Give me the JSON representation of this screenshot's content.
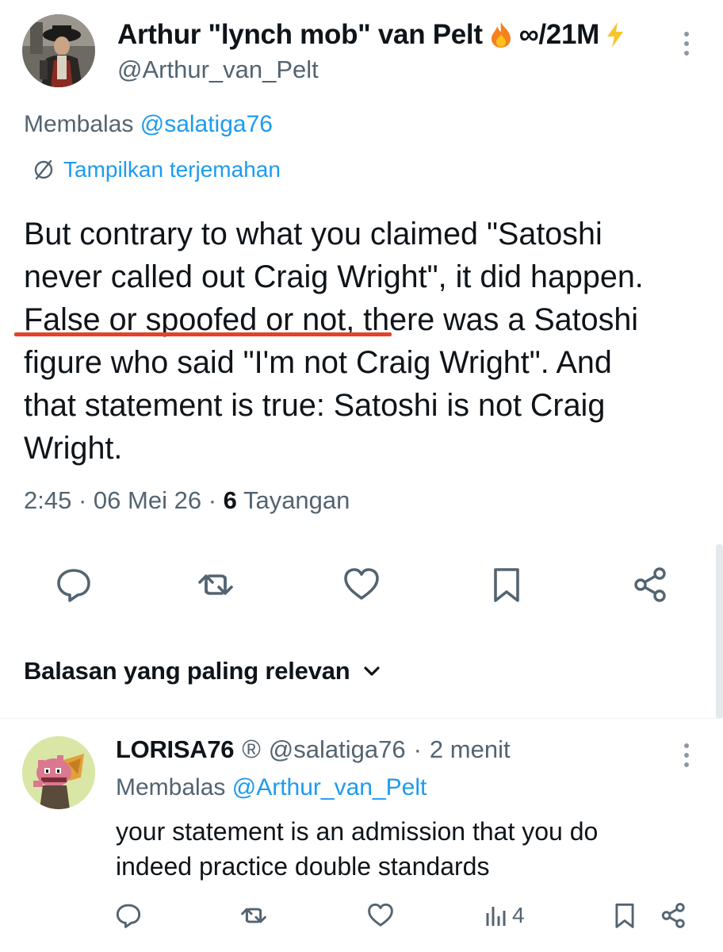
{
  "tweet": {
    "author_name": "Arthur \"lynch mob\" van Pelt",
    "handle": "@Arthur_van_Pelt",
    "name_suffix": "∞/21M",
    "replying_prefix": "Membalas",
    "replying_to": "@salatiga76",
    "translate_label": "Tampilkan terjemahan",
    "text_lines": [
      "But contrary to what you claimed \"Satoshi",
      "never called out Craig Wright\", it did happen.",
      "False or spoofed or not, there was a Satoshi",
      "figure who said \"I'm not Craig Wright\". And",
      "that statement is true: Satoshi is not Craig",
      "Wright."
    ],
    "time": "2:45",
    "date": "06 Mei 26",
    "views_count": "6",
    "views_label": "Tayangan",
    "separator": "·"
  },
  "sort_label": "Balasan yang paling relevan",
  "reply": {
    "author_name": "LORISA76",
    "badge": "®",
    "handle": "@salatiga76",
    "time_ago": "2 menit",
    "separator": "·",
    "replying_prefix": "Membalas",
    "replying_to": "@Arthur_van_Pelt",
    "text_lines": [
      "your statement is an admission that you do",
      "indeed practice double standards"
    ],
    "views": "4"
  },
  "colors": {
    "text": "#0f1419",
    "muted": "#536471",
    "link": "#1d9bf0",
    "highlight_underline": "#e2432a"
  },
  "icons": [
    "fire-icon",
    "lightning-icon",
    "more-icon",
    "translate-icon",
    "reply-icon",
    "retweet-icon",
    "like-icon",
    "bookmark-icon",
    "share-icon",
    "chevron-down-icon",
    "views-icon"
  ]
}
